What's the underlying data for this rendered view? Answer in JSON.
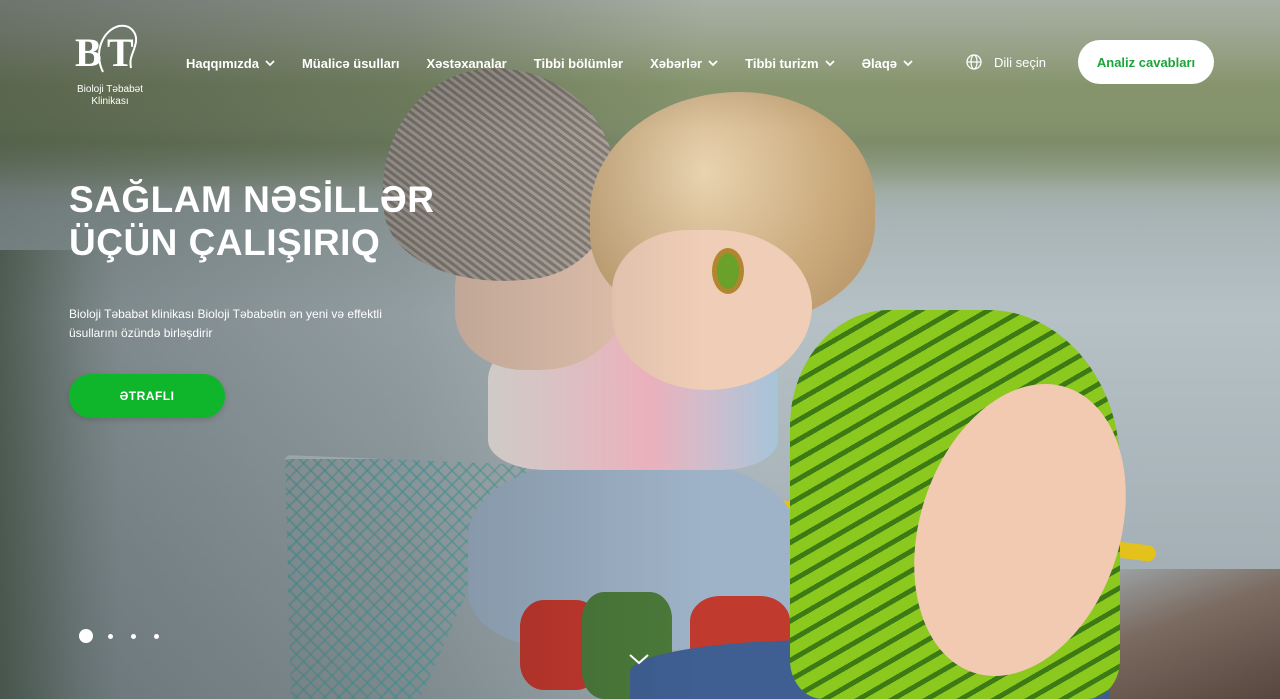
{
  "logo": {
    "mark": "BT",
    "line1": "Bioloji Təbabət",
    "line2": "Klinikası"
  },
  "nav": {
    "items": [
      {
        "label": "Haqqımızda",
        "dropdown": true
      },
      {
        "label": "Müalicə üsulları",
        "dropdown": false
      },
      {
        "label": "Xəstəxanalar",
        "dropdown": false
      },
      {
        "label": "Tibbi bölümlər",
        "dropdown": false
      },
      {
        "label": "Xəbərlər",
        "dropdown": true
      },
      {
        "label": "Tibbi turizm",
        "dropdown": true
      },
      {
        "label": "Əlaqə",
        "dropdown": true
      }
    ],
    "language_label": "Dili seçin",
    "results_button": "Analiz cavabları"
  },
  "hero": {
    "title_line1": "SAĞLAM NƏSİLLƏR",
    "title_line2": "ÜÇÜN ÇALIŞIRIQ",
    "description": "Bioloji Təbabət klinikası Bioloji Təbabətin ən yeni və effektli üsullarını özündə birləşdirir",
    "more_button": "ƏTRAFLI"
  },
  "slider": {
    "total_slides": 4,
    "active_slide": 1
  },
  "colors": {
    "accent_green": "#0fb52a",
    "button_text_green": "#1aa53a",
    "white": "#ffffff"
  },
  "icons": {
    "language": "globe-icon",
    "dropdown": "chevron-down-icon",
    "scroll": "chevron-down-icon"
  }
}
